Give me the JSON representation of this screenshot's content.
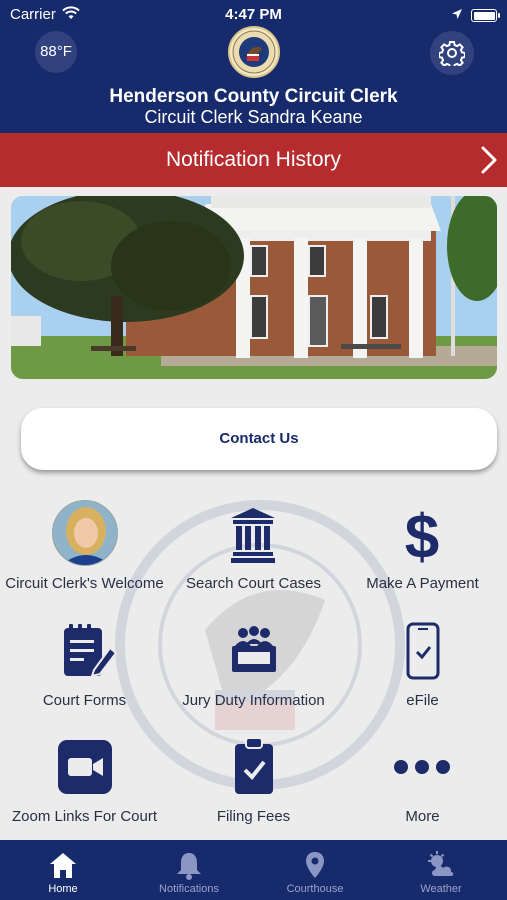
{
  "status_bar": {
    "carrier": "Carrier",
    "time": "4:47 PM"
  },
  "header": {
    "temperature": "88°F",
    "title": "Henderson County Circuit Clerk",
    "subtitle": "Circuit Clerk Sandra Keane"
  },
  "notification_bar": {
    "label": "Notification History"
  },
  "contact": {
    "label": "Contact Us"
  },
  "grid": [
    {
      "label": "Circuit Clerk's Welcome",
      "icon": "avatar"
    },
    {
      "label": "Search Court Cases",
      "icon": "courthouse-icon"
    },
    {
      "label": "Make A Payment",
      "icon": "dollar-icon"
    },
    {
      "label": "Court Forms",
      "icon": "form-edit-icon"
    },
    {
      "label": "Jury Duty Information",
      "icon": "jury-box-icon"
    },
    {
      "label": "eFile",
      "icon": "mobile-check-icon"
    },
    {
      "label": "Zoom Links For Court",
      "icon": "video-camera-icon"
    },
    {
      "label": "Filing Fees",
      "icon": "clipboard-check-icon"
    },
    {
      "label": "More",
      "icon": "ellipsis-icon"
    }
  ],
  "tabs": [
    {
      "label": "Home",
      "icon": "home-icon",
      "active": true
    },
    {
      "label": "Notifications",
      "icon": "bell-icon",
      "active": false
    },
    {
      "label": "Courthouse",
      "icon": "map-pin-icon",
      "active": false
    },
    {
      "label": "Weather",
      "icon": "cloud-sun-icon",
      "active": false
    }
  ],
  "colors": {
    "navy": "#172a6b",
    "red": "#b52b2e",
    "background": "#ececec"
  }
}
